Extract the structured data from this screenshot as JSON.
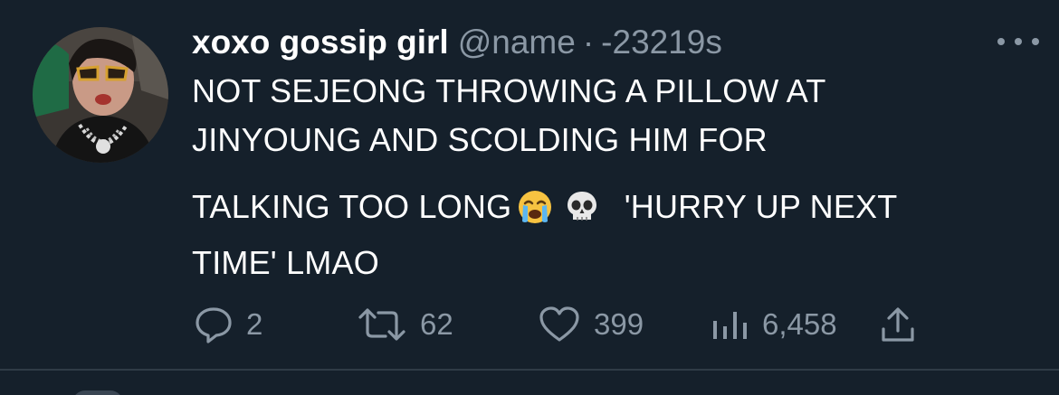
{
  "tweet": {
    "display_name": "xoxo gossip girl",
    "handle": "@name",
    "separator": "·",
    "timestamp": "-23219s",
    "text_lines": [
      "NOT SEJEONG THROWING A PILLOW AT",
      "JINYOUNG AND SCOLDING HIM FOR",
      "TALKING TOO LONG",
      "'HURRY UP NEXT",
      "TIME' LMAO"
    ],
    "emojis": [
      "loudly-crying-face",
      "skull"
    ]
  },
  "actions": {
    "replies": "2",
    "retweets": "62",
    "likes": "399",
    "views": "6,458"
  },
  "colors": {
    "background": "#15202b",
    "text": "#ffffff",
    "secondary": "#8b98a5",
    "divider": "#2f3b46"
  },
  "icons": [
    "reply-icon",
    "retweet-icon",
    "like-icon",
    "views-icon",
    "share-icon",
    "more-icon"
  ]
}
